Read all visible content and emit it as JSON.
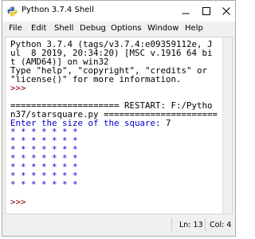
{
  "window": {
    "title": "Python 3.7.4 Shell",
    "icon": "python-logo-icon",
    "controls": [
      "minimize-icon",
      "maximize-icon",
      "close-icon"
    ]
  },
  "menu": {
    "items": [
      "File",
      "Edit",
      "Shell",
      "Debug",
      "Options",
      "Window",
      "Help"
    ]
  },
  "shell": {
    "banner_lines": [
      "Python 3.7.4 (tags/v3.7.4:e09359112e, J",
      "ul  8 2019, 20:34:20) [MSC v.1916 64 bi",
      "t (AMD64)] on win32",
      "Type \"help\", \"copyright\", \"credits\" or",
      "\"license()\" for more information."
    ],
    "prompt_1": ">>>",
    "restart_lines": [
      "===================== RESTART: F:/Pytho",
      "n37/starsquare.py ======================"
    ],
    "input_prompt": "Enter the size of the square: ",
    "input_value": "7",
    "star_rows": [
      "* * * * * * *",
      "* * * * * * *",
      "* * * * * * *",
      "* * * * * * *",
      "* * * * * * *",
      "* * * * * * *",
      "* * * * * * *"
    ],
    "prompt_2": ">>>"
  },
  "status": {
    "line": "Ln: 13",
    "col": "Col: 4"
  },
  "colors": {
    "prompt": "#8b0000",
    "stdout_program": "#0000cd",
    "text": "#000000",
    "background": "#ffffff"
  }
}
